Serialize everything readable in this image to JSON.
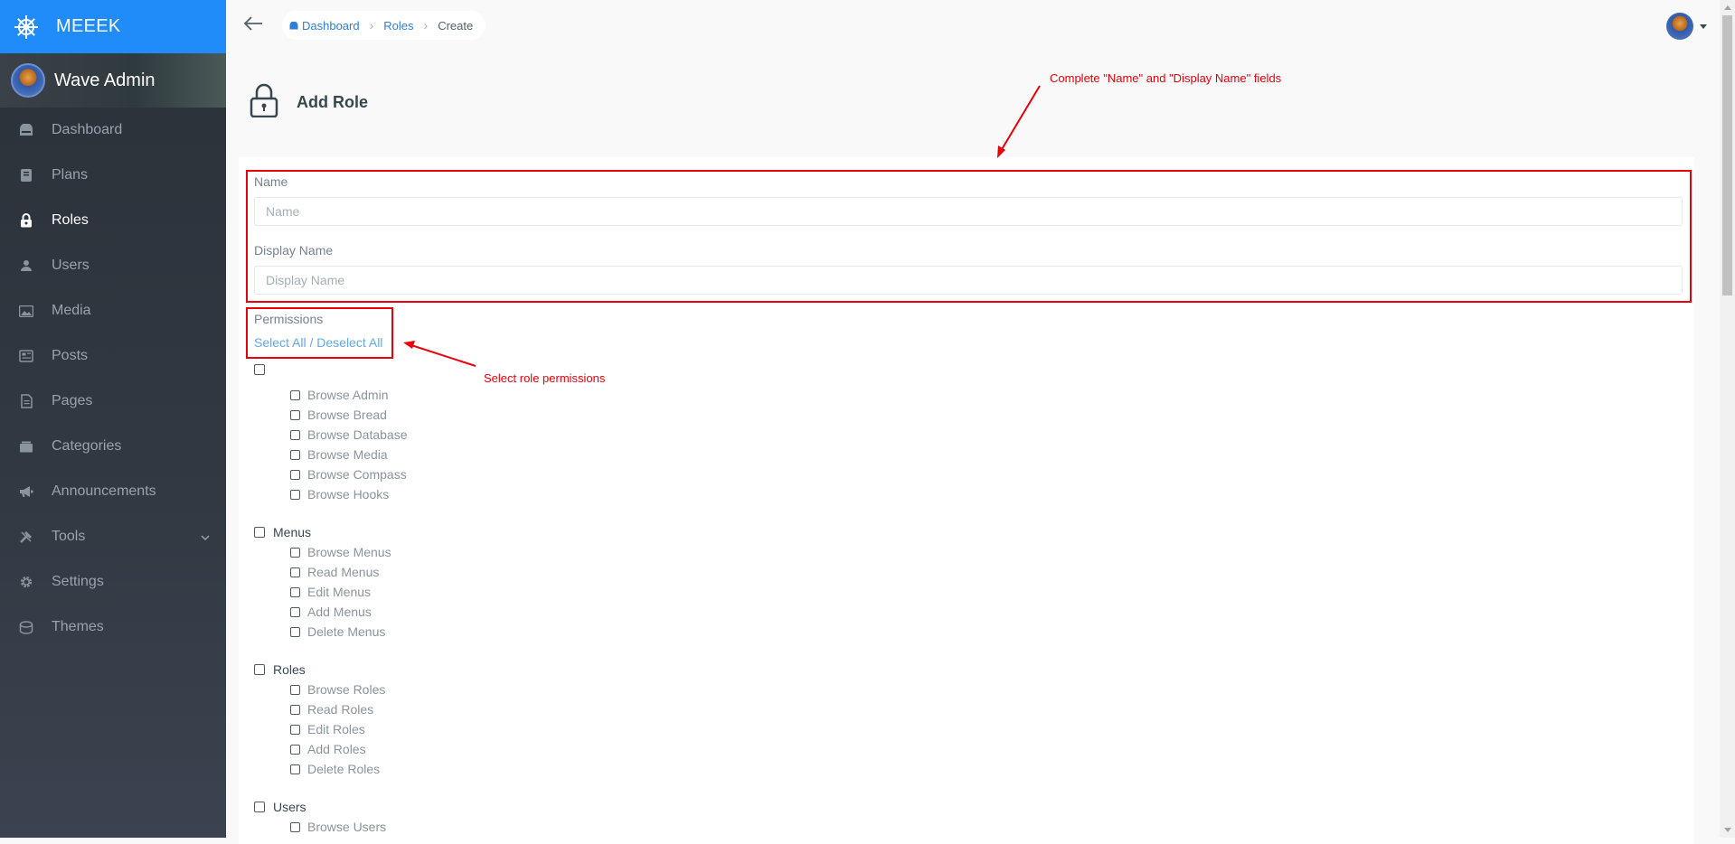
{
  "brand": {
    "name": "MEEEK"
  },
  "profile": {
    "name": "Wave Admin"
  },
  "sidebar": {
    "items": [
      {
        "label": "Dashboard",
        "icon": "dashboard-icon"
      },
      {
        "label": "Plans",
        "icon": "plans-icon"
      },
      {
        "label": "Roles",
        "icon": "lock-icon",
        "active": true
      },
      {
        "label": "Users",
        "icon": "user-icon"
      },
      {
        "label": "Media",
        "icon": "image-icon"
      },
      {
        "label": "Posts",
        "icon": "news-icon"
      },
      {
        "label": "Pages",
        "icon": "file-icon"
      },
      {
        "label": "Categories",
        "icon": "categories-icon"
      },
      {
        "label": "Announcements",
        "icon": "megaphone-icon"
      },
      {
        "label": "Tools",
        "icon": "tools-icon"
      },
      {
        "label": "Settings",
        "icon": "gear-icon"
      },
      {
        "label": "Themes",
        "icon": "paint-bucket-icon"
      }
    ]
  },
  "breadcrumb": {
    "dashboard": "Dashboard",
    "roles": "Roles",
    "current": "Create"
  },
  "page": {
    "title": "Add Role"
  },
  "form": {
    "name_label": "Name",
    "name_placeholder": "Name",
    "display_label": "Display Name",
    "display_placeholder": "Display Name",
    "permissions_label": "Permissions",
    "select_all": "Select All",
    "slash": " / ",
    "deselect_all": "Deselect All"
  },
  "groups": [
    {
      "label": "",
      "items": [
        "Browse Admin",
        "Browse Bread",
        "Browse Database",
        "Browse Media",
        "Browse Compass",
        "Browse Hooks"
      ]
    },
    {
      "label": "Menus",
      "items": [
        "Browse Menus",
        "Read Menus",
        "Edit Menus",
        "Add Menus",
        "Delete Menus"
      ]
    },
    {
      "label": "Roles",
      "items": [
        "Browse Roles",
        "Read Roles",
        "Edit Roles",
        "Add Roles",
        "Delete Roles"
      ]
    },
    {
      "label": "Users",
      "items": [
        "Browse Users"
      ]
    }
  ],
  "annotations": {
    "top_note": "Complete \"Name\" and \"Display Name\" fields",
    "perm_note": "Select role permissions",
    "color": "#e8000a"
  },
  "colors": {
    "brand": "#1f8cf9",
    "sidebar": "#2b3138",
    "link": "#62a8ea"
  }
}
